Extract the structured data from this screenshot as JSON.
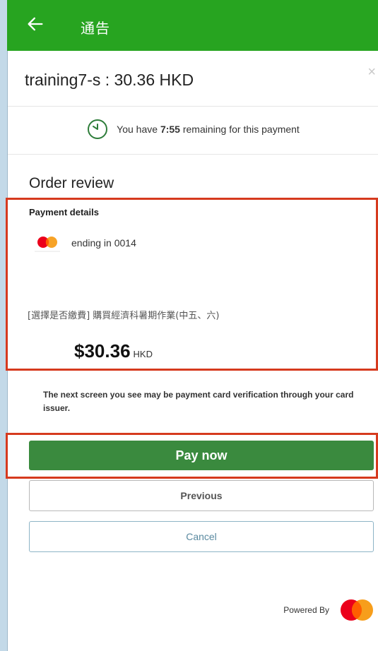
{
  "app_bar": {
    "title": "通告",
    "back_icon": "arrow-left-icon"
  },
  "header": {
    "title": "training7-s : 30.36 HKD",
    "close_symbol": "×"
  },
  "timer": {
    "prefix": "You have ",
    "time": "7:55",
    "suffix": " remaining for this payment"
  },
  "order": {
    "section_title": "Order review",
    "payment_details_label": "Payment details",
    "card_text": "ending in 0014",
    "item_description": "[選擇是否繳費] 購買經濟科暑期作業(中五、六)",
    "amount": "$30.36",
    "currency": "HKD"
  },
  "notice": "The next screen you see may be payment card verification through your card issuer.",
  "buttons": {
    "pay": "Pay now",
    "previous": "Previous",
    "cancel": "Cancel"
  },
  "footer": {
    "powered_by": "Powered By"
  },
  "colors": {
    "app_bar": "#27a420",
    "pay_button": "#3a8a3e",
    "highlight": "#d63a1e",
    "mastercard_red": "#eb001b",
    "mastercard_orange": "#f79e1b"
  }
}
